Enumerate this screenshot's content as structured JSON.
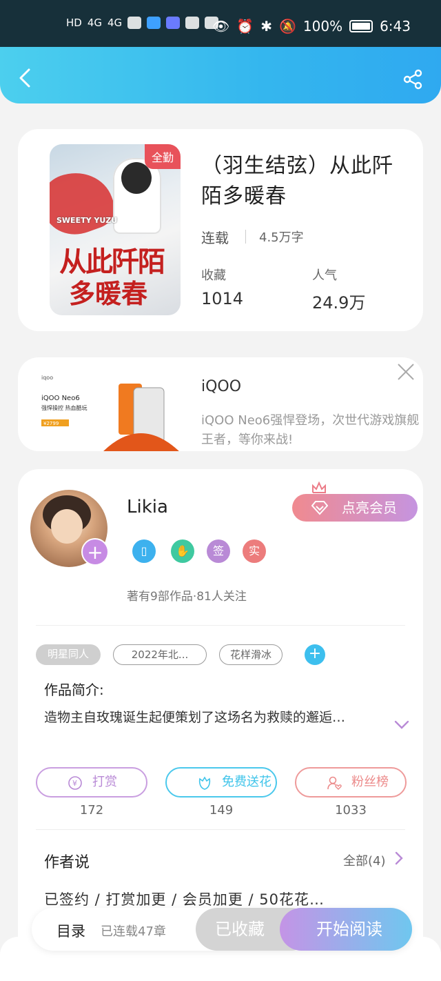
{
  "status_bar": {
    "battery": "100%",
    "time": "6:43",
    "network": [
      "HD",
      "4G",
      "4G"
    ]
  },
  "header": {
    "back_icon": "chevron-left-icon",
    "share_icon": "share-icon",
    "gradient": [
      "#4ccfee",
      "#2fa9f0"
    ]
  },
  "book": {
    "badge": "全勤",
    "title": "（羽生结弦）从此阡陌多暖春",
    "status": "连载",
    "words": "4.5万字",
    "stats": [
      {
        "label": "收藏",
        "value": "1014"
      },
      {
        "label": "人气",
        "value": "24.9万"
      }
    ],
    "cover": {
      "caption": "SWEETY YUZU",
      "title_line1": "从此阡陌",
      "title_line2": "多暖春"
    }
  },
  "ad": {
    "brand": "iQOO",
    "description": "iQOO Neo6强悍登场，次世代游戏旗舰王者，等你来战!",
    "image_text": {
      "logo": "iqoo",
      "model": "iQOO Neo6",
      "slogan": "强悍操控 热血酷玩",
      "price": "¥2799"
    }
  },
  "author": {
    "name": "Likia",
    "vip_button": "点亮会员",
    "medals": [
      "签",
      "实"
    ],
    "meta": "著有9部作品·81人关注",
    "tags": [
      "明星同人",
      "2022年北...",
      "花样滑冰"
    ],
    "intro_label": "作品简介:",
    "intro_text": "造物主自玫瑰诞生起便策划了这场名为救赎的邂逅…",
    "actions": [
      {
        "label": "打赏",
        "count": "172",
        "color": "#b98ad6"
      },
      {
        "label": "免费送花",
        "count": "149",
        "color": "#3fc4ea"
      },
      {
        "label": "粉丝榜",
        "count": "1033",
        "color": "#ec8a8a"
      }
    ],
    "author_says_label": "作者说",
    "author_says_more": "全部(4)",
    "author_says_text": "已签约 / 打赏加更 / 会员加更 / 50花花…"
  },
  "bottom_bar": {
    "toc": "目录",
    "chapters": "已连载47章",
    "collected": "已收藏",
    "start_reading": "开始阅读"
  }
}
